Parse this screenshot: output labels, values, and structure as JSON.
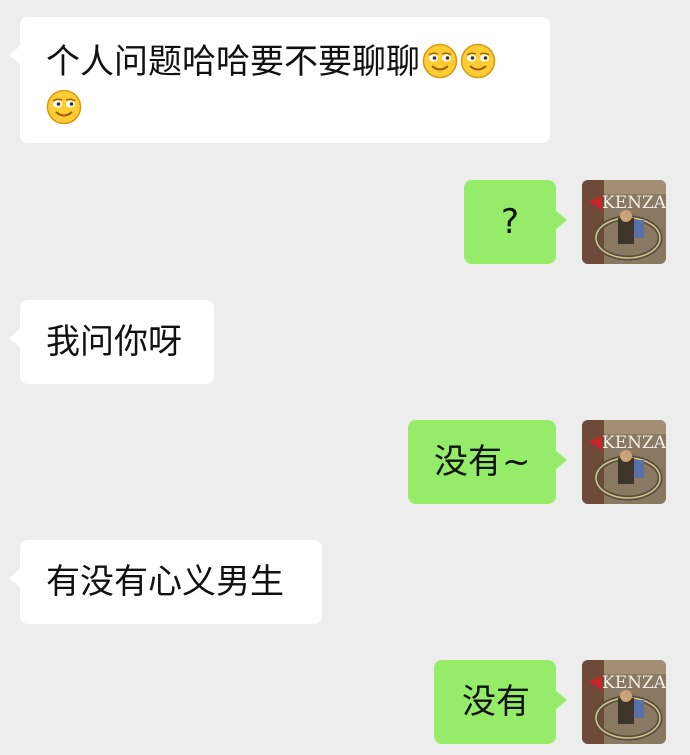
{
  "messages": [
    {
      "side": "in",
      "text": "个人问题哈哈要不要聊聊"
    },
    {
      "side": "out",
      "text": "?"
    },
    {
      "side": "in",
      "text": "我问你呀"
    },
    {
      "side": "out",
      "text": "没有~"
    },
    {
      "side": "in",
      "text": "有没有心义男生"
    },
    {
      "side": "out",
      "text": "没有"
    }
  ],
  "avatar": {
    "brand_text": "KENZA"
  },
  "emoji": {
    "name": "smiling-face-emoji",
    "count": 3
  },
  "colors": {
    "background": "#ededed",
    "incoming_bubble": "#ffffff",
    "outgoing_bubble": "#95ec69"
  }
}
